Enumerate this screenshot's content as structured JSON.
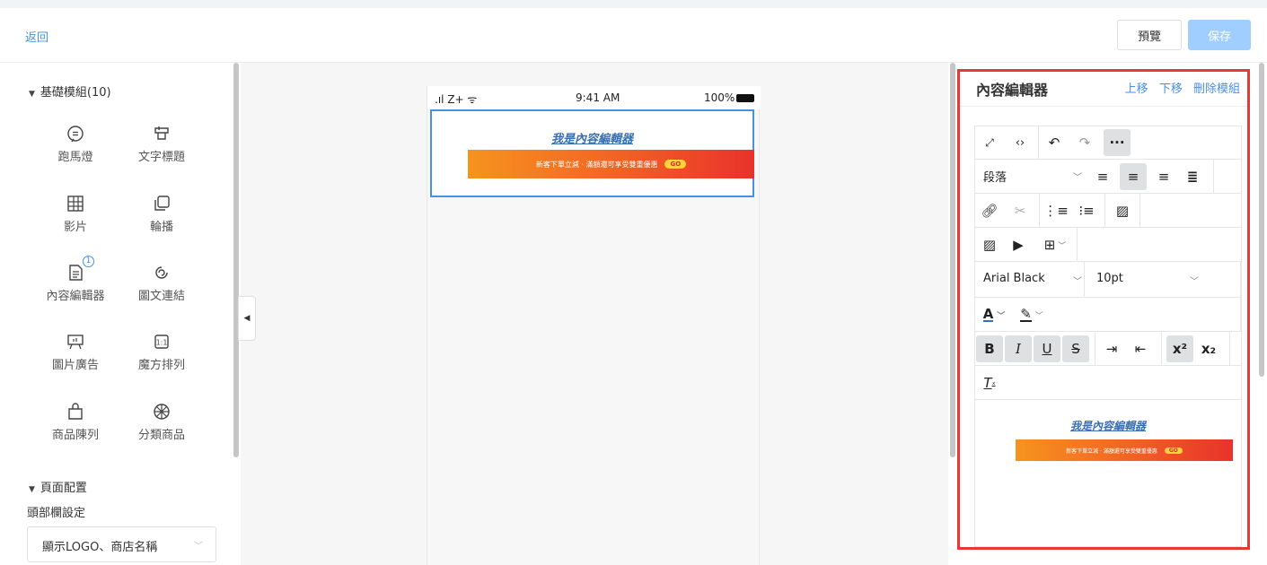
{
  "header": {
    "back": "返回",
    "preview": "預覽",
    "save": "保存"
  },
  "left": {
    "section_basic": "基礎模組(10)",
    "modules": [
      {
        "label": "跑馬燈",
        "icon": "chat-bubble-icon"
      },
      {
        "label": "文字標題",
        "icon": "title-icon"
      },
      {
        "label": "影片",
        "icon": "grid-icon"
      },
      {
        "label": "輪播",
        "icon": "carousel-icon"
      },
      {
        "label": "內容編輯器",
        "icon": "document-icon",
        "badge": "1"
      },
      {
        "label": "圖文連結",
        "icon": "link-icon"
      },
      {
        "label": "圖片廣告",
        "icon": "billboard-icon"
      },
      {
        "label": "魔方排列",
        "icon": "cube-icon"
      },
      {
        "label": "商品陳列",
        "icon": "shopping-bag-icon"
      },
      {
        "label": "分類商品",
        "icon": "wheel-icon"
      }
    ],
    "section_page": "頁面配置",
    "header_setting_label": "頭部欄設定",
    "header_setting_value": "顯示LOGO、商店名稱"
  },
  "phone": {
    "signal": ".ıl Z+ ᯤ",
    "time": "9:41 AM",
    "battery": "100%",
    "content_title": "我是內容編輯器",
    "banner_text": "新客下單立減 · 滿額還可享受雙重優惠",
    "banner_go": "GO"
  },
  "editor": {
    "title": "內容編輯器",
    "actions": [
      "上移",
      "下移",
      "刪除模組"
    ],
    "paragraph_select": "段落",
    "font_family": "Arial Black",
    "font_size": "10pt",
    "text_color_label": "A",
    "content_title": "我是內容編輯器",
    "banner_text": "新客下單立減 · 滿額還可享受雙重優惠",
    "banner_go": "GO"
  },
  "colors": {
    "accent": "#4a90e2",
    "highlight_border": "#e53935",
    "banner_start": "#f6931e",
    "banner_end": "#e8322b"
  }
}
